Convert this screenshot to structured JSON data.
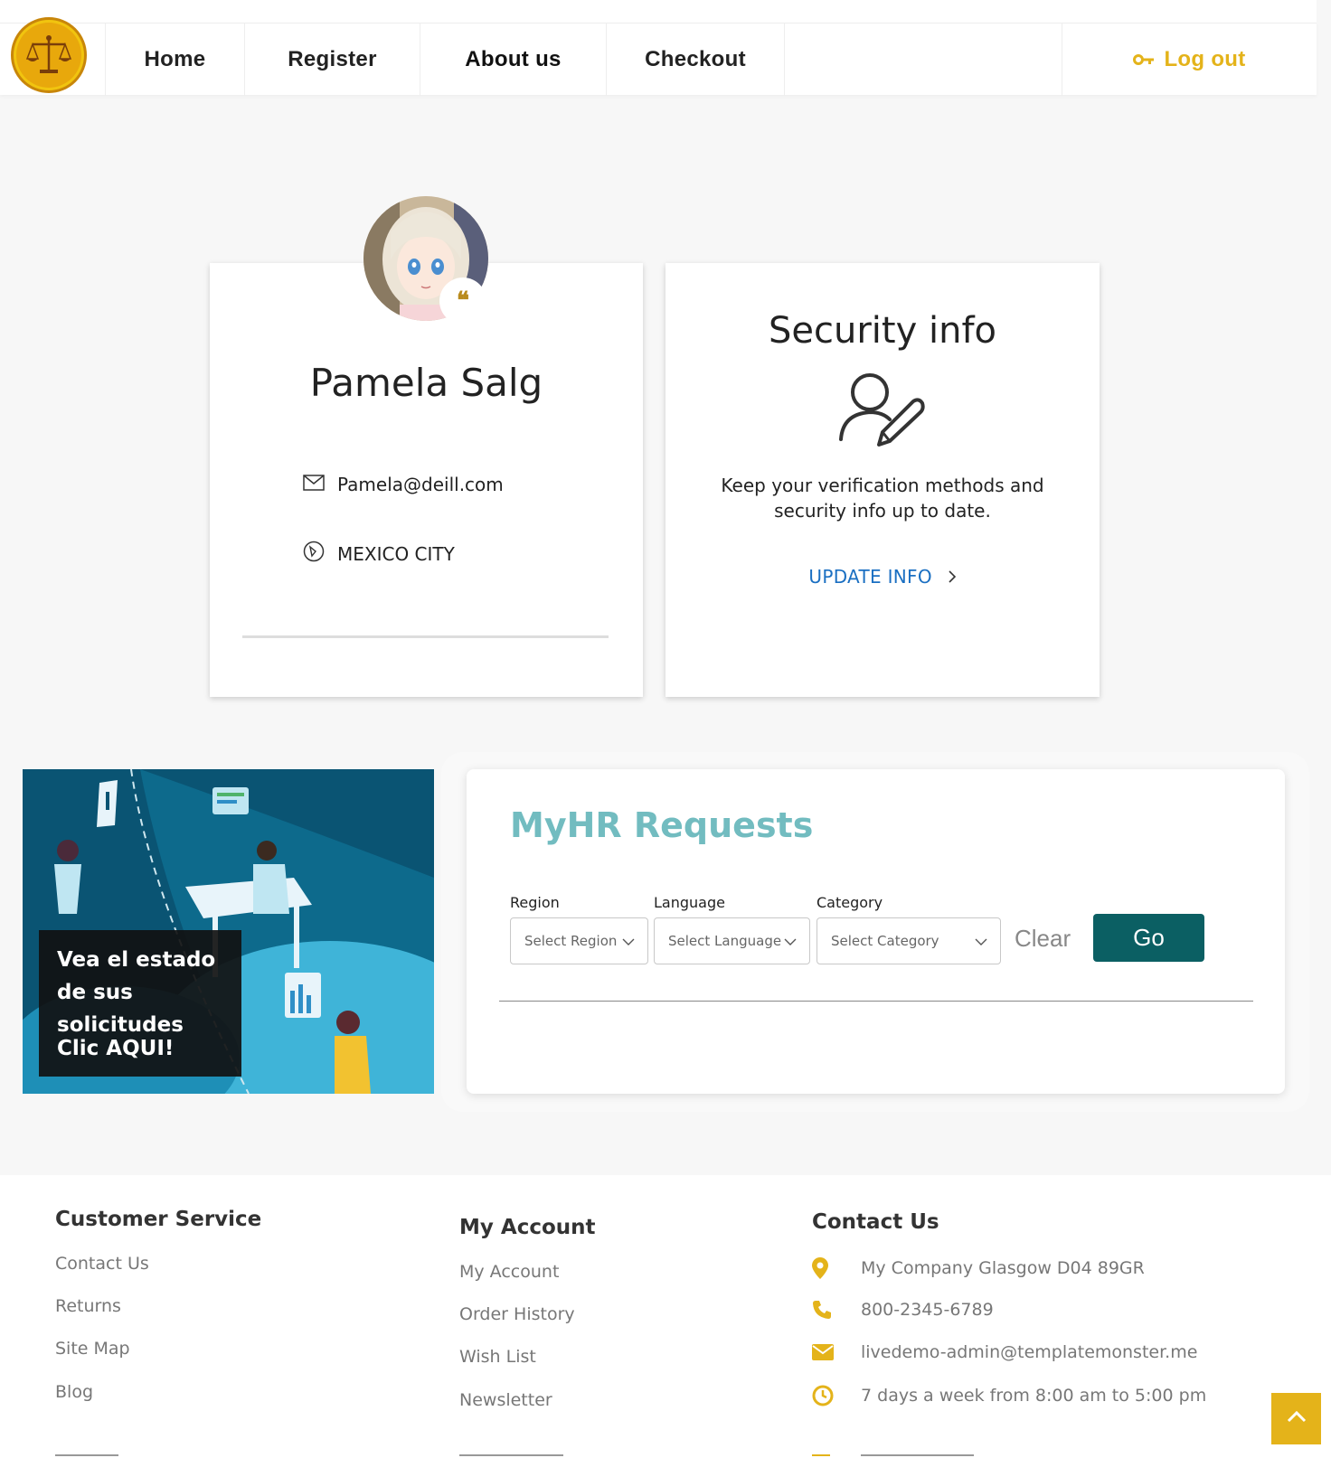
{
  "nav": {
    "home": "Home",
    "register": "Register",
    "about": "About us",
    "checkout": "Checkout",
    "logout": "Log out"
  },
  "profile": {
    "name": "Pamela Salg",
    "email": "Pamela@deill.com",
    "city": "MEXICO CITY"
  },
  "security": {
    "title": "Security info",
    "description": "Keep your verification methods and security info up to date.",
    "link": "UPDATE INFO"
  },
  "promo": {
    "text": "Vea el estado de sus solicitudes",
    "cta": "Clic AQUI!"
  },
  "myhr": {
    "title": "MyHR Requests",
    "region_label": "Region",
    "region_placeholder": "Select Region",
    "language_label": "Language",
    "language_placeholder": "Select Language",
    "category_label": "Category",
    "category_placeholder": "Select Category",
    "clear": "Clear",
    "go": "Go"
  },
  "footer": {
    "customer_service": {
      "title": "Customer Service",
      "links": [
        "Contact Us",
        "Returns",
        "Site Map",
        "Blog"
      ]
    },
    "my_account": {
      "title": "My Account",
      "links": [
        "My Account",
        "Order History",
        "Wish List",
        "Newsletter"
      ]
    },
    "contact": {
      "title": "Contact Us",
      "address": "My Company Glasgow D04 89GR",
      "phone": "800-2345-6789",
      "email": "livedemo-admin@templatemonster.me",
      "hours": "7 days a week from 8:00 am to 5:00 pm"
    }
  },
  "colors": {
    "accent_gold": "#e4b31a",
    "teal_title": "#72bcc0",
    "go_button": "#0b5f63",
    "link_blue": "#1a6fc2"
  }
}
